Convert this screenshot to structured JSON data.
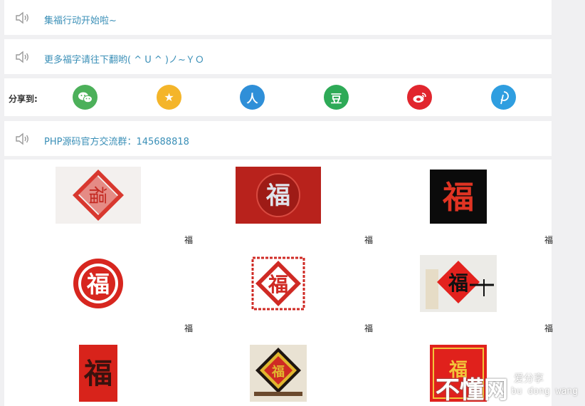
{
  "notices": [
    {
      "text": "集福行动开始啦~"
    },
    {
      "text": "更多福字请往下翻哟( ^ U ^ )ノ~ＹＯ"
    },
    {
      "text": "PHP源码官方交流群：145688818"
    }
  ],
  "share": {
    "label": "分享到:",
    "buttons": [
      {
        "name": "wechat",
        "glyph": "",
        "color": "#4cb05a"
      },
      {
        "name": "qzone",
        "glyph": "★",
        "color": "#f4b52a"
      },
      {
        "name": "renren",
        "glyph": "人",
        "color": "#2f8fd8"
      },
      {
        "name": "douban",
        "glyph": "豆",
        "color": "#2eaa57"
      },
      {
        "name": "weibo",
        "glyph": "",
        "color": "#e1262e"
      },
      {
        "name": "pinterest",
        "glyph": "",
        "color": "#2f9ee0"
      }
    ]
  },
  "gallery": {
    "captions": [
      "福",
      "福",
      "福",
      "福",
      "福",
      "福"
    ],
    "image_char": "福"
  },
  "watermark": {
    "main": "不懂网",
    "side": "爱分享",
    "pinyin": "bu dong wang"
  }
}
